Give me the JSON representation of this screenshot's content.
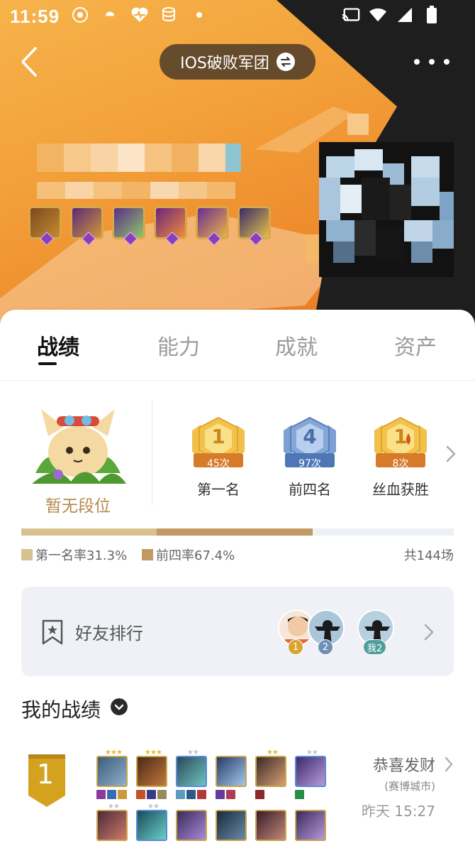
{
  "status_bar": {
    "time": "11:59"
  },
  "header": {
    "title": "IOS破败军团"
  },
  "tabs": [
    {
      "label": "战绩",
      "active": true
    },
    {
      "label": "能力",
      "active": false
    },
    {
      "label": "成就",
      "active": false
    },
    {
      "label": "资产",
      "active": false
    }
  ],
  "rank": {
    "label": "暂无段位"
  },
  "medals": [
    {
      "label": "第一名",
      "count": "45次",
      "symbol": "1",
      "color": "#e8b43a"
    },
    {
      "label": "前四名",
      "count": "97次",
      "symbol": "4",
      "color": "#6f93c9"
    },
    {
      "label": "丝血获胜",
      "count": "8次",
      "symbol": "1",
      "color": "#e8b43a"
    }
  ],
  "stats": {
    "first_rate_label": "第一名率31.3%",
    "first_rate": 0.313,
    "top4_rate_label": "前四率67.4%",
    "top4_rate": 0.674,
    "total_label": "共144场"
  },
  "friends": {
    "label": "好友排行",
    "ranks": [
      "1",
      "2",
      "我2"
    ]
  },
  "my_record": {
    "title": "我的战绩",
    "match": {
      "placement": "1",
      "comp_name": "恭喜发财",
      "map": "(赛博城市)",
      "time": "昨天 15:27"
    }
  },
  "colors": {
    "accent_gold": "#d8c08f",
    "accent_brown": "#c19a63",
    "placement_gold": "#d4a21f"
  }
}
